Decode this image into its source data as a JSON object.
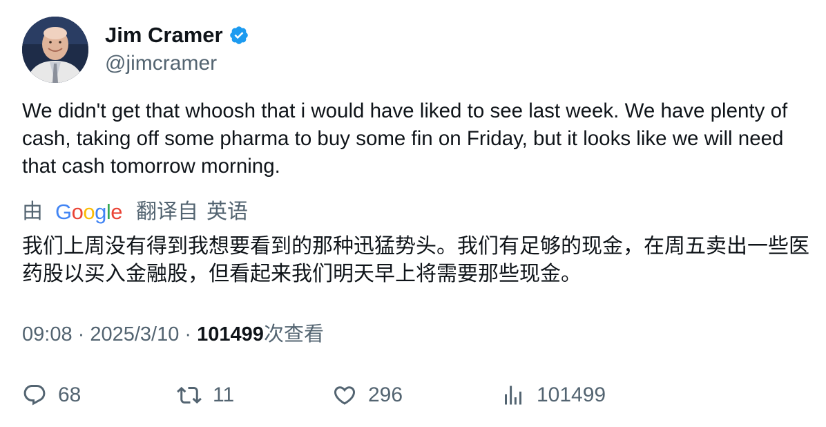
{
  "author": {
    "display_name": "Jim Cramer",
    "handle": "@jimcramer",
    "verified_icon": "verified-badge-icon",
    "verified_color": "#1d9bf0"
  },
  "tweet": {
    "text": "We didn't get that whoosh that i would have liked to see last week. We have plenty of cash, taking off some pharma to buy some fin on Friday,  but it looks like we will need that cash tomorrow morning."
  },
  "translation": {
    "by_label": "由",
    "provider": "Google",
    "from_label": "翻译自",
    "language": "英语",
    "text": "我们上周没有得到我想要看到的那种迅猛势头。我们有足够的现金，在周五卖出一些医药股以买入金融股，但看起来我们明天早上将需要那些现金。"
  },
  "meta": {
    "time": "09:08",
    "separator": " · ",
    "date": "2025/3/10",
    "views_count": "101499",
    "views_label": "次查看"
  },
  "actions": {
    "replies": "68",
    "retweets": "11",
    "likes": "296",
    "views": "101499"
  },
  "colors": {
    "text_primary": "#0f1419",
    "text_secondary": "#536471"
  }
}
